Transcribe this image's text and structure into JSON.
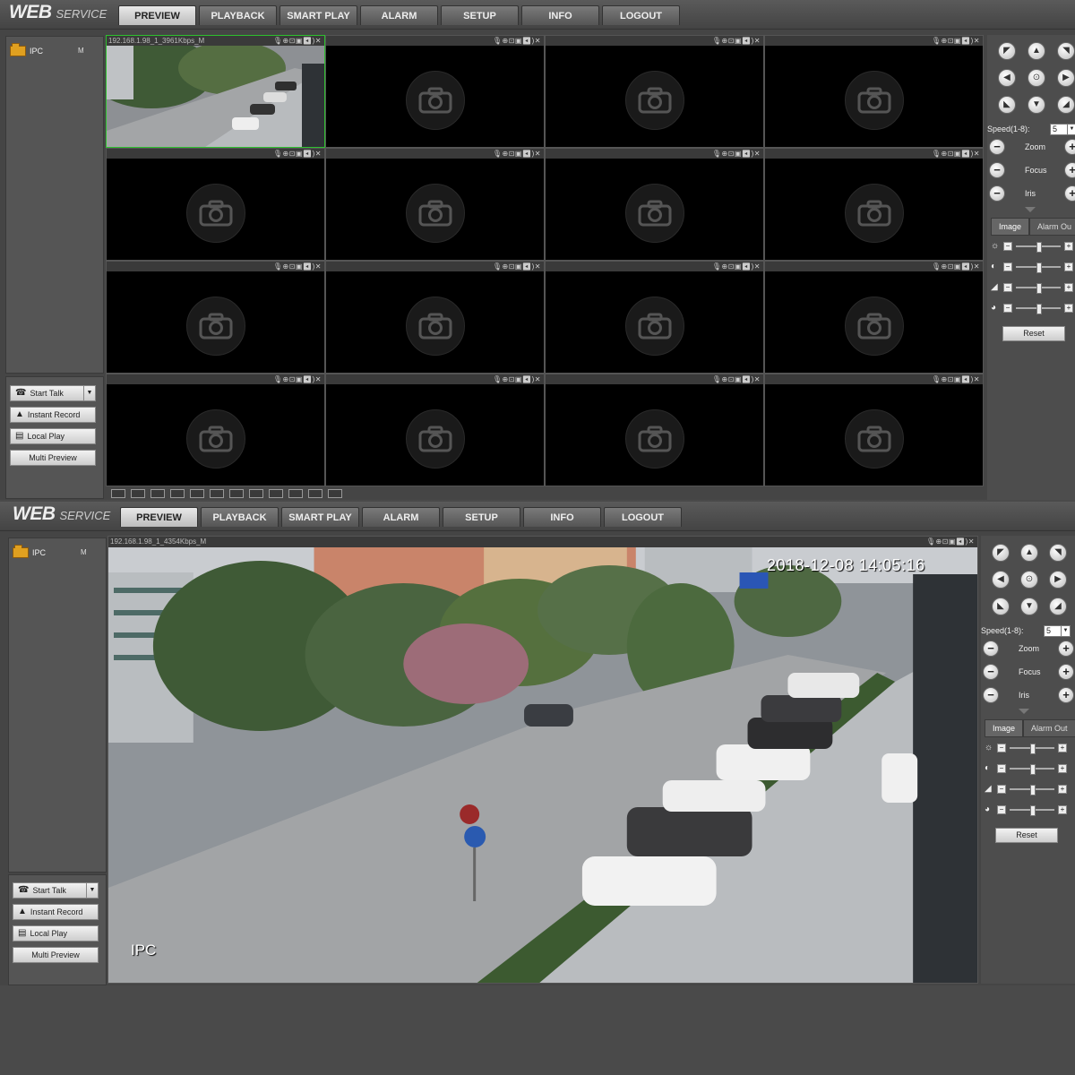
{
  "app": {
    "logo_main": "WEB",
    "logo_sub": "SERVICE"
  },
  "tabs": [
    "PREVIEW",
    "PLAYBACK",
    "SMART PLAY",
    "ALARM",
    "SETUP",
    "INFO",
    "LOGOUT"
  ],
  "device": {
    "name": "IPC",
    "stream": "M"
  },
  "actions": {
    "start_talk": "Start Talk",
    "instant_record": "Instant Record",
    "local_play": "Local Play",
    "multi_preview": "Multi Preview"
  },
  "ptz": {
    "speed_label": "Speed(1-8):",
    "speed_value": "5",
    "zoom_label": "Zoom",
    "focus_label": "Focus",
    "iris_label": "Iris",
    "minus": "−",
    "plus": "+"
  },
  "image_panel": {
    "tab_image": "Image",
    "tab_alarm_top": "Alarm Ou",
    "tab_alarm_bottom": "Alarm Out",
    "reset_label": "Reset"
  },
  "screen1": {
    "channel_title": "192.168.1.98_1_3961Kbps_M"
  },
  "screen2": {
    "channel_title": "192.168.1.98_1_4354Kbps_M",
    "osd_datetime": "2018-12-08 14:05:16",
    "osd_channel": "IPC"
  },
  "cell_tools": "🎙⊕⊡▣◀)✕",
  "icons": [
    "camera-icon",
    "phone-icon",
    "record-icon",
    "film-icon",
    "sun-icon",
    "contrast-icon",
    "saturation-icon",
    "palette-icon"
  ],
  "colors": {
    "selected_border": "#2ec02e",
    "active_tab": "#d8d8d8"
  }
}
